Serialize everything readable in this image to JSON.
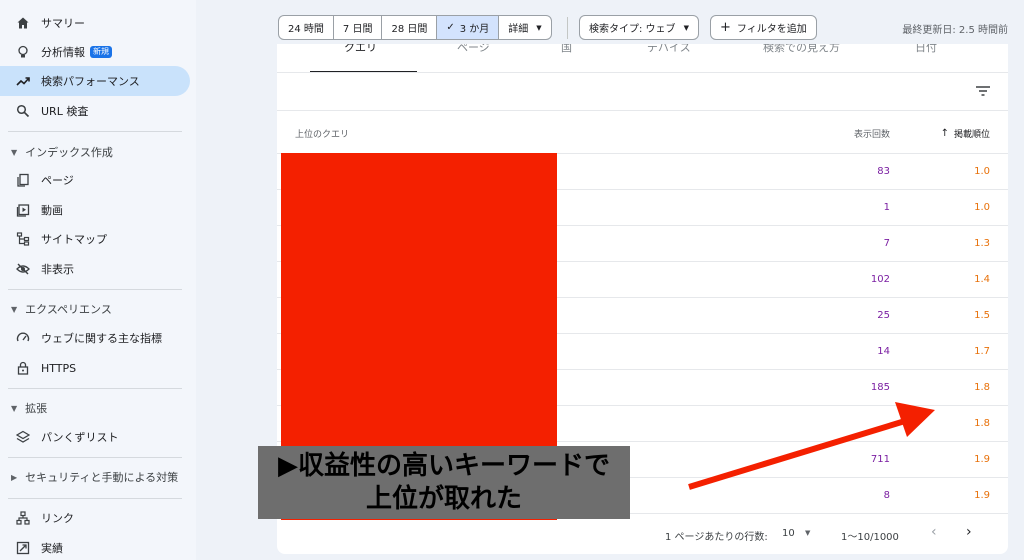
{
  "sidebar": {
    "items": [
      {
        "label": "サマリー",
        "icon": "home-icon"
      },
      {
        "label": "分析情報",
        "icon": "lightbulb-icon",
        "badge": "新規"
      },
      {
        "label": "検索パフォーマンス",
        "icon": "trending-up-icon",
        "active": true
      },
      {
        "label": "URL 検査",
        "icon": "search-icon"
      }
    ],
    "index_section": {
      "title": "インデックス作成",
      "items": [
        {
          "label": "ページ",
          "icon": "pages-icon"
        },
        {
          "label": "動画",
          "icon": "video-icon"
        },
        {
          "label": "サイトマップ",
          "icon": "sitemap-icon"
        },
        {
          "label": "非表示",
          "icon": "eye-off-icon"
        }
      ]
    },
    "experience_section": {
      "title": "エクスペリエンス",
      "items": [
        {
          "label": "ウェブに関する主な指標",
          "icon": "gauge-icon"
        },
        {
          "label": "HTTPS",
          "icon": "lock-icon"
        }
      ]
    },
    "enhancements_section": {
      "title": "拡張",
      "items": [
        {
          "label": "パンくずリスト",
          "icon": "layers-icon"
        }
      ]
    },
    "security_section": {
      "title": "セキュリティと手動による対策"
    },
    "bottom_items": [
      {
        "label": "リンク",
        "icon": "links-icon"
      },
      {
        "label": "実績",
        "icon": "achievements-icon"
      }
    ]
  },
  "toolbar": {
    "date_options": [
      "24 時間",
      "7 日間",
      "28 日間",
      "3 か月",
      "詳細"
    ],
    "selected_date": "3 か月",
    "search_type": "検索タイプ: ウェブ",
    "add_filter": "フィルタを追加",
    "last_updated": "最終更新日: 2.5 時間前"
  },
  "tabs": [
    "クエリ",
    "ページ",
    "国",
    "デバイス",
    "検索での見え方",
    "日付"
  ],
  "table": {
    "columns": {
      "query": "上位のクエリ",
      "impressions": "表示回数",
      "position": "掲載順位"
    },
    "rows": [
      {
        "impressions": "83",
        "position": "1.0"
      },
      {
        "impressions": "1",
        "position": "1.0"
      },
      {
        "impressions": "7",
        "position": "1.3"
      },
      {
        "impressions": "102",
        "position": "1.4"
      },
      {
        "impressions": "25",
        "position": "1.5"
      },
      {
        "impressions": "14",
        "position": "1.7"
      },
      {
        "impressions": "185",
        "position": "1.8"
      },
      {
        "impressions": "",
        "position": "1.8"
      },
      {
        "impressions": "711",
        "position": "1.9"
      },
      {
        "impressions": "8",
        "position": "1.9"
      }
    ]
  },
  "pager": {
    "rows_per_page_label": "1 ページあたりの行数:",
    "rows_per_page": "10",
    "range": "1〜10/1000"
  },
  "annotation": {
    "line1": "▶収益性の高いキーワードで",
    "line2": "上位が取れた",
    "redaction_color": "#f42000",
    "arrow_color": "#f42000"
  },
  "colors": {
    "impressions": "#7b1fa2",
    "position": "#e8710a",
    "active_nav": "#c9e2fb"
  }
}
